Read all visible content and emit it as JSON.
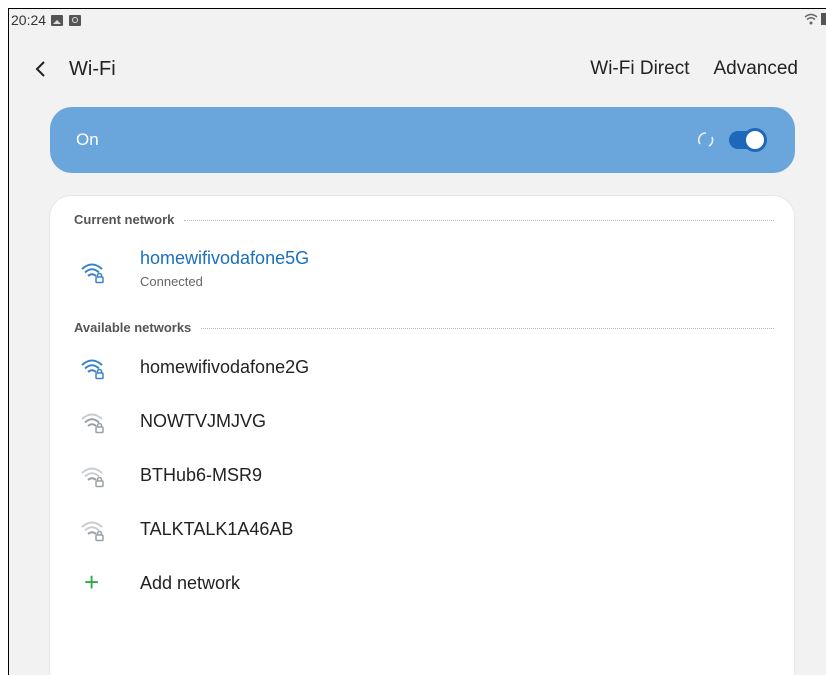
{
  "status_bar": {
    "time": "20:24",
    "icons": [
      "gallery-icon",
      "camera-icon"
    ],
    "right_icons": [
      "wifi-icon",
      "battery-icon"
    ]
  },
  "header": {
    "title": "Wi-Fi",
    "actions": {
      "wifi_direct": "Wi-Fi Direct",
      "advanced": "Advanced"
    }
  },
  "master_switch": {
    "label": "On",
    "state": "on"
  },
  "sections": {
    "current": "Current network",
    "available": "Available networks"
  },
  "current_network": {
    "name": "homewifivodafone5G",
    "status": "Connected",
    "secured": true
  },
  "available_networks": [
    {
      "name": "homewifivodafone2G",
      "secured": true,
      "signal": "strong"
    },
    {
      "name": "NOWTVJMJVG",
      "secured": true,
      "signal": "weak"
    },
    {
      "name": "BTHub6-MSR9",
      "secured": true,
      "signal": "weak"
    },
    {
      "name": "TALKTALK1A46AB",
      "secured": true,
      "signal": "weak"
    }
  ],
  "add_network": {
    "label": "Add network"
  },
  "colors": {
    "accent": "#6aa5db",
    "switch": "#1d68b8",
    "connected_text": "#1a6fbf",
    "strong_wifi": "#3b83c7",
    "weak_wifi": "#9aa0a6",
    "add": "#2eaa4a"
  }
}
